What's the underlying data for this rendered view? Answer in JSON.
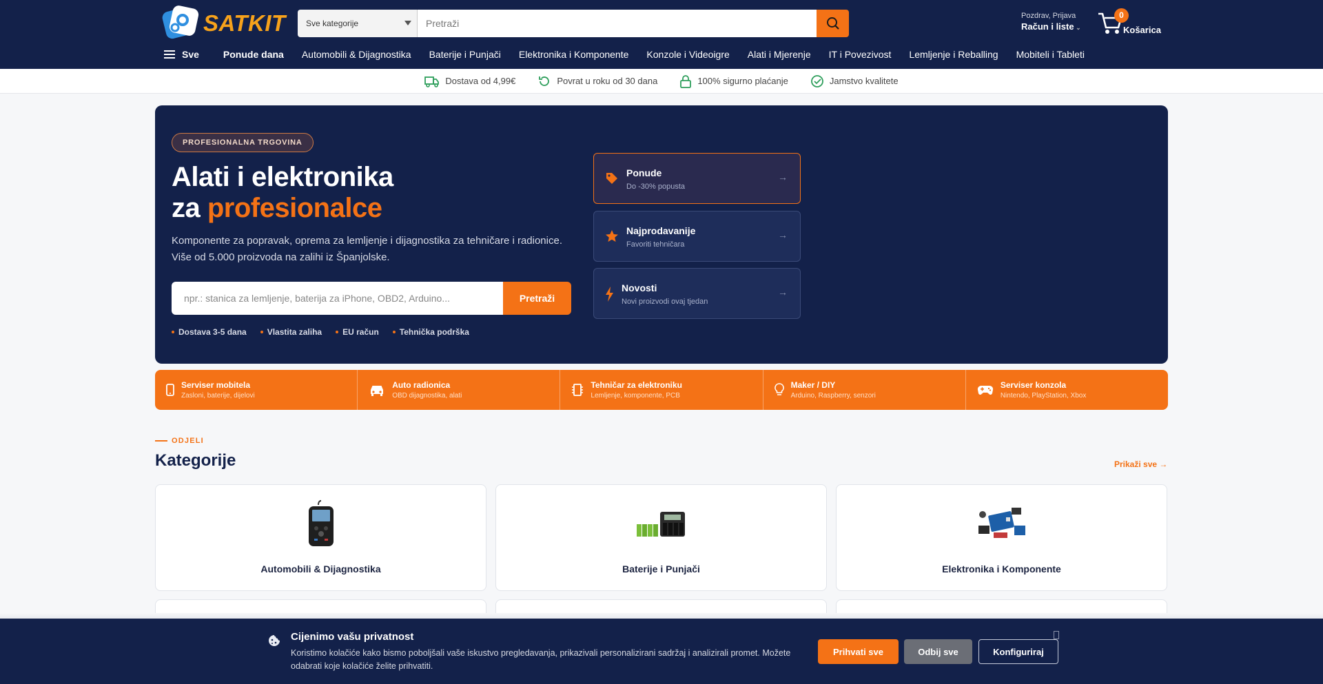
{
  "brand": {
    "name": "SATKIT"
  },
  "header": {
    "category_select": "Sve kategorije",
    "search_placeholder": "Pretraži",
    "greeting": "Pozdrav, Prijava",
    "account_label": "Račun i liste",
    "cart_count": "0",
    "cart_label": "Košarica"
  },
  "nav": {
    "all_label": "Sve",
    "items": [
      "Ponude dana",
      "Automobili & Dijagnostika",
      "Baterije i Punjači",
      "Elektronika i Komponente",
      "Konzole i Videoigre",
      "Alati i Mjerenje",
      "IT i Povezivost",
      "Lemljenje i Reballing",
      "Mobiteli i Tableti"
    ]
  },
  "trust": [
    {
      "icon": "truck-icon",
      "text": "Dostava od 4,99€"
    },
    {
      "icon": "return-icon",
      "text": "Povrat u roku od 30 dana"
    },
    {
      "icon": "lock-icon",
      "text": "100% sigurno plaćanje"
    },
    {
      "icon": "check-circle-icon",
      "text": "Jamstvo kvalitete"
    }
  ],
  "hero": {
    "badge": "PROFESIONALNA TRGOVINA",
    "title_line1": "Alati i elektronika",
    "title_line2_pre": "za ",
    "title_highlight": "profesionalce",
    "subtitle": "Komponente za popravak, oprema za lemljenje i dijagnostika za tehničare i radionice. Više od 5.000 proizvoda na zalihi iz Španjolske.",
    "search_placeholder": "npr.: stanica za lemljenje, baterija za iPhone, OBD2, Arduino...",
    "search_button": "Pretraži",
    "bullets": [
      "Dostava 3-5 dana",
      "Vlastita zaliha",
      "EU račun",
      "Tehnička podrška"
    ],
    "cards": [
      {
        "title": "Ponude",
        "desc": "Do -30% popusta",
        "icon": "tag-icon"
      },
      {
        "title": "Najprodavanije",
        "desc": "Favoriti tehničara",
        "icon": "star-icon"
      },
      {
        "title": "Novosti",
        "desc": "Novi proizvodi ovaj tjedan",
        "icon": "bolt-icon"
      }
    ],
    "card_arrow": "→"
  },
  "segments": [
    {
      "title": "Serviser mobitela",
      "desc": "Zasloni, baterije, dijelovi",
      "icon": "phone-icon"
    },
    {
      "title": "Auto radionica",
      "desc": "OBD dijagnostika, alati",
      "icon": "car-icon"
    },
    {
      "title": "Tehničar za elektroniku",
      "desc": "Lemljenje, komponente, PCB",
      "icon": "chip-icon"
    },
    {
      "title": "Maker / DIY",
      "desc": "Arduino, Raspberry, senzori",
      "icon": "bulb-icon"
    },
    {
      "title": "Serviser konzola",
      "desc": "Nintendo, PlayStation, Xbox",
      "icon": "gamepad-icon"
    }
  ],
  "categories_section": {
    "eyebrow": "ODJELI",
    "title": "Kategorije",
    "show_all": "Prikaži sve →",
    "items": [
      {
        "name": "Automobili & Dijagnostika",
        "icon": "obd-scanner-icon"
      },
      {
        "name": "Baterije i Punjači",
        "icon": "battery-charger-icon"
      },
      {
        "name": "Elektronika i Komponente",
        "icon": "electronic-kit-icon"
      }
    ]
  },
  "cookie": {
    "title": "Cijenimo vašu privatnost",
    "text": "Koristimo kolačiće kako bismo poboljšali vaše iskustvo pregledavanja, prikazivali personalizirani sadržaj i analizirali promet. Možete odabrati koje kolačiće želite prihvatiti.",
    "accept": "Prihvati sve",
    "reject": "Odbij sve",
    "configure": "Konfiguriraj"
  },
  "colors": {
    "navy": "#13214a",
    "accent": "#f47216"
  }
}
